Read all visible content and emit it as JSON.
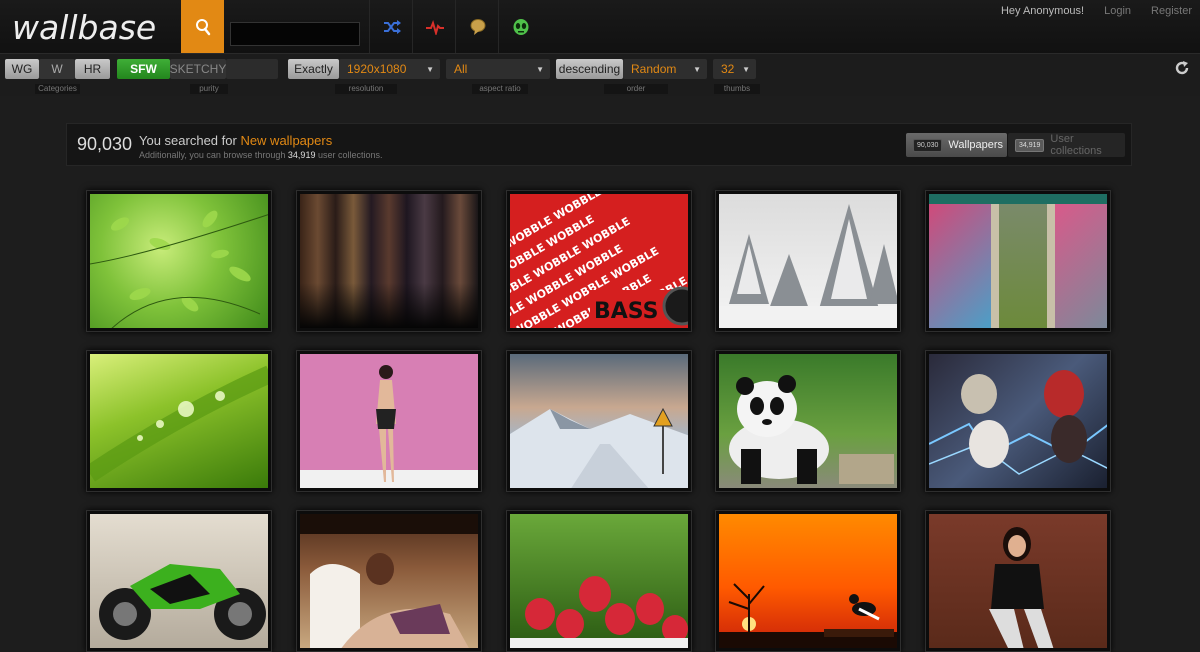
{
  "header": {
    "logo": "wallbase",
    "search": {
      "value": "",
      "placeholder": ""
    },
    "icons": [
      "search-icon",
      "shuffle-icon",
      "pulse-icon",
      "speech-bubble-icon",
      "alien-icon"
    ],
    "greeting": "Hey Anonymous!",
    "login": "Login",
    "register": "Register"
  },
  "filters": {
    "categories": {
      "wg": "WG",
      "w": "W",
      "hr": "HR",
      "label": "Categories"
    },
    "purity": {
      "sfw": "SFW",
      "sketchy": "SKETCHY",
      "label": "purity"
    },
    "resolution": {
      "mode": "Exactly",
      "value": "1920x1080",
      "label": "resolution"
    },
    "aspect": {
      "value": "All",
      "label": "aspect ratio"
    },
    "order": {
      "direction": "descending",
      "value": "Random",
      "label": "order"
    },
    "thumbs": {
      "value": "32",
      "label": "thumbs"
    }
  },
  "results": {
    "count": "90,030",
    "searched_prefix": "You searched for ",
    "searched_term": "New wallpapers",
    "additional_prefix": "Additionally, you can browse through ",
    "additional_count": "34,919",
    "additional_suffix": " user collections.",
    "tabs": {
      "wallpapers": {
        "count": "90,030",
        "label": "Wallpapers"
      },
      "collections": {
        "count": "34,919",
        "label": "User collections"
      }
    }
  },
  "thumbnails": [
    {
      "subject": "green leaves"
    },
    {
      "subject": "fantasy characters lineup"
    },
    {
      "subject": "wobble bass",
      "caption": "BASS",
      "pattern": "WOBBLE WOBBLE WOBBLE"
    },
    {
      "subject": "snowy trees"
    },
    {
      "subject": "graffiti shutters"
    },
    {
      "subject": "grass with water drops"
    },
    {
      "subject": "woman on pink background"
    },
    {
      "subject": "snowy mountain road"
    },
    {
      "subject": "panda"
    },
    {
      "subject": "anime girls"
    },
    {
      "subject": "green motorcycle"
    },
    {
      "subject": "woman on couch"
    },
    {
      "subject": "strawberries"
    },
    {
      "subject": "sunset with bird"
    },
    {
      "subject": "woman sitting"
    }
  ],
  "colors": {
    "accent": "#e28914",
    "green": "#3fae37",
    "background": "#1d1d1d"
  }
}
